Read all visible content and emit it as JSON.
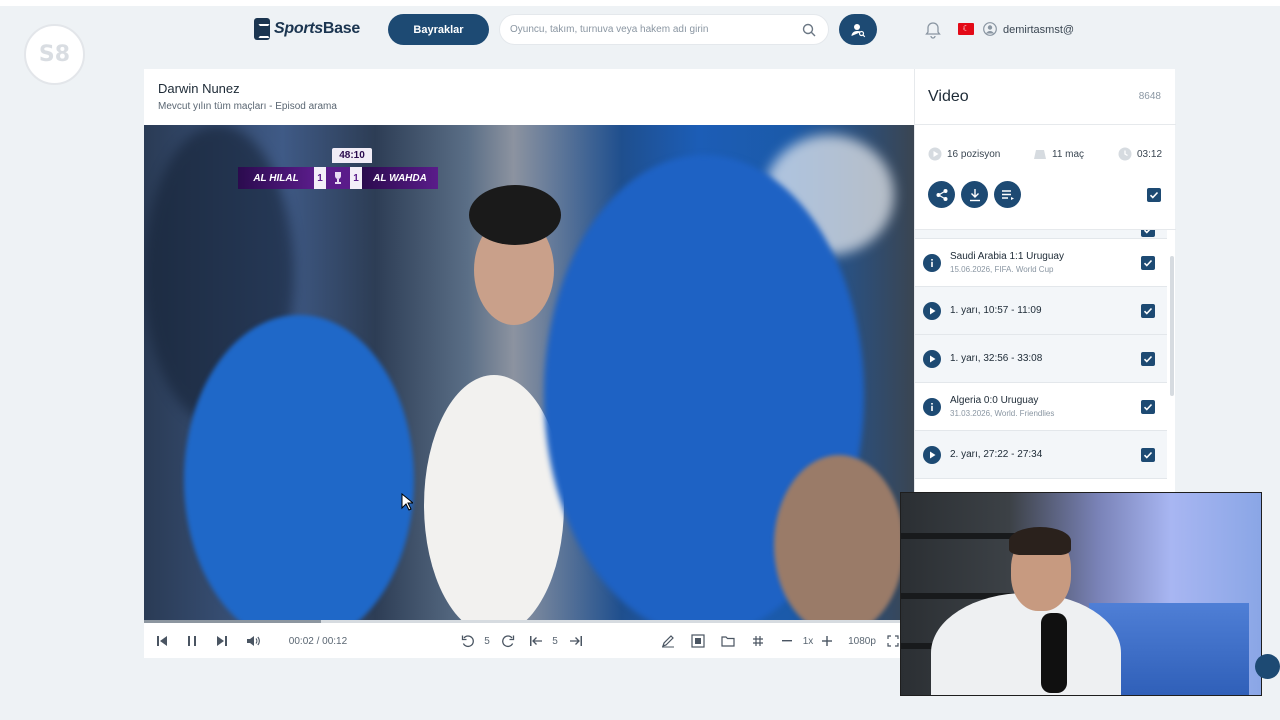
{
  "channel_logo": "S8",
  "brand": {
    "name_prefix": "Sports",
    "name_suffix": "Base"
  },
  "header": {
    "flags_button": "Bayraklar",
    "search_placeholder": "Oyuncu, takım, turnuva veya hakem adı girin",
    "username": "demirtasmst@",
    "flag_symbol": "☾"
  },
  "player": {
    "title": "Darwin Nunez",
    "subtitle": "Mevcut yılın tüm maçları - Episod arama",
    "scoreboard": {
      "home": "AL HILAL",
      "home_score": "1",
      "away_score": "1",
      "away": "AL WAHDA",
      "clock": "48:10"
    },
    "progress": 0.23,
    "controls": {
      "time": "00:02 / 00:12",
      "rewind_seconds": "5",
      "skip_clips": "5",
      "speed": "1x",
      "quality": "1080p"
    }
  },
  "side": {
    "title": "Video",
    "count": "8648",
    "stats": {
      "positions": "16 pozisyon",
      "matches": "11 maç",
      "duration": "03:12"
    },
    "items": [
      {
        "type": "match",
        "title": "Saudi Arabia 1:1 Uruguay",
        "sub": "15.06.2026, FIFA. World Cup"
      },
      {
        "type": "clip",
        "title": "1. yarı, 10:57 - 11:09"
      },
      {
        "type": "clip",
        "title": "1. yarı, 32:56 - 33:08"
      },
      {
        "type": "match",
        "title": "Algeria 0:0 Uruguay",
        "sub": "31.03.2026, World. Friendlies"
      },
      {
        "type": "clip",
        "title": "2. yarı, 27:22 - 27:34"
      }
    ]
  },
  "colors": {
    "accent": "#1d4a73",
    "background": "#eef2f5",
    "scoreboard": "#5a1c8a"
  }
}
